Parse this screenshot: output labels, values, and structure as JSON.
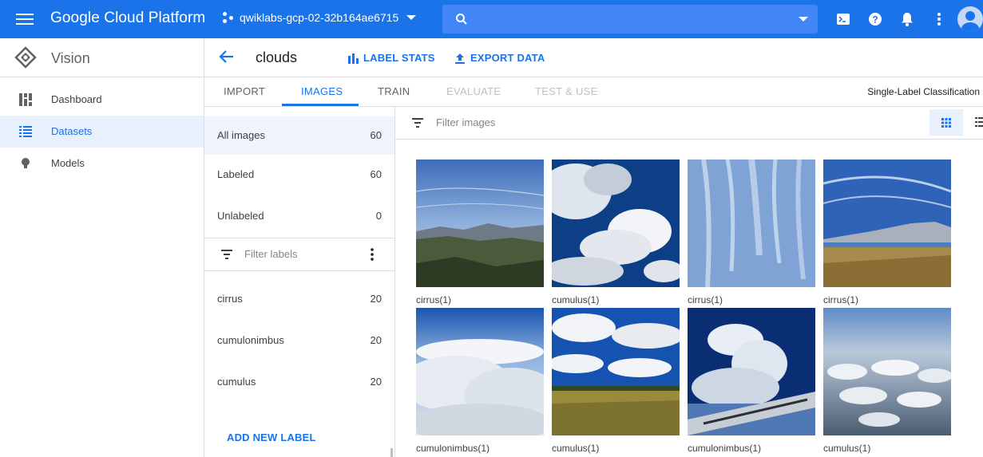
{
  "topbar": {
    "brand": "Google Cloud Platform",
    "project": "qwiklabs-gcp-02-32b164ae6715",
    "accent": "#1a73e8"
  },
  "sidebar": {
    "title": "Vision",
    "items": [
      {
        "label": "Dashboard",
        "icon": "dashboard-icon"
      },
      {
        "label": "Datasets",
        "icon": "list-icon",
        "active": true
      },
      {
        "label": "Models",
        "icon": "lightbulb-icon"
      }
    ]
  },
  "header": {
    "title": "clouds",
    "label_stats": "LABEL STATS",
    "export_data": "EXPORT DATA"
  },
  "tabs": [
    {
      "label": "IMPORT"
    },
    {
      "label": "IMAGES",
      "active": true
    },
    {
      "label": "TRAIN"
    },
    {
      "label": "EVALUATE",
      "disabled": true
    },
    {
      "label": "TEST & USE",
      "disabled": true
    }
  ],
  "classification": "Single-Label Classification",
  "filters": {
    "all": {
      "label": "All images",
      "count": "60"
    },
    "labeled": {
      "label": "Labeled",
      "count": "60"
    },
    "unlabeled": {
      "label": "Unlabeled",
      "count": "0"
    },
    "filter_labels_placeholder": "Filter labels",
    "labels": [
      {
        "label": "cirrus",
        "count": "20"
      },
      {
        "label": "cumulonimbus",
        "count": "20"
      },
      {
        "label": "cumulus",
        "count": "20"
      }
    ],
    "add_label": "ADD NEW LABEL"
  },
  "grid": {
    "filter_placeholder": "Filter images",
    "images": [
      {
        "caption": "cirrus(1)"
      },
      {
        "caption": "cumulus(1)"
      },
      {
        "caption": "cirrus(1)"
      },
      {
        "caption": "cirrus(1)"
      },
      {
        "caption": "cumulonimbus(1)"
      },
      {
        "caption": "cumulus(1)"
      },
      {
        "caption": "cumulonimbus(1)"
      },
      {
        "caption": "cumulus(1)"
      }
    ]
  }
}
